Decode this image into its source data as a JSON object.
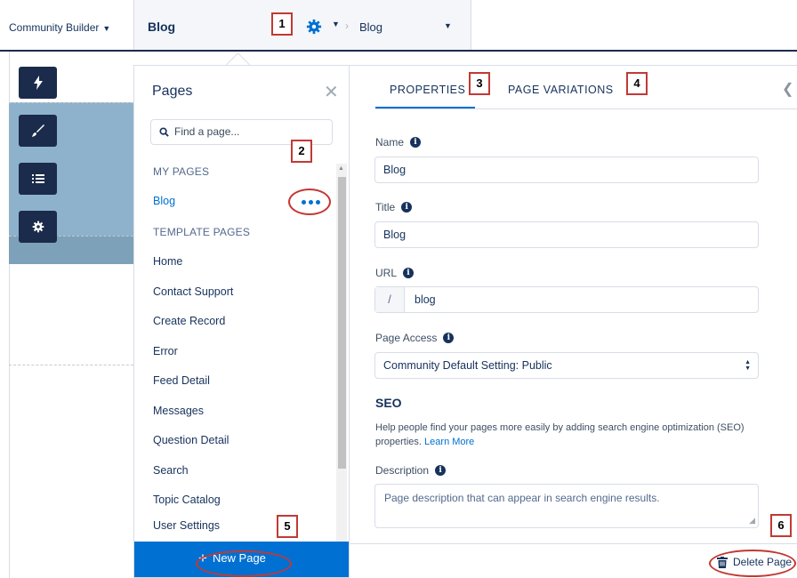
{
  "topbar": {
    "builder_label": "Community Builder",
    "current_page": "Blog",
    "page_dropdown": "Blog"
  },
  "callouts": [
    "1",
    "2",
    "3",
    "4",
    "5",
    "6"
  ],
  "pages_panel": {
    "title": "Pages",
    "search_placeholder": "Find a page...",
    "my_pages_heading": "MY PAGES",
    "my_pages": [
      "Blog"
    ],
    "template_heading": "TEMPLATE PAGES",
    "template_pages": [
      "Home",
      "Contact Support",
      "Create Record",
      "Error",
      "Feed Detail",
      "Messages",
      "Question Detail",
      "Search",
      "Topic Catalog",
      "User Settings"
    ],
    "new_page_label": "New Page"
  },
  "properties": {
    "tabs": [
      "PROPERTIES",
      "PAGE VARIATIONS"
    ],
    "name_label": "Name",
    "name_value": "Blog",
    "title_label": "Title",
    "title_value": "Blog",
    "url_label": "URL",
    "url_prefix": "/",
    "url_value": "blog",
    "access_label": "Page Access",
    "access_value": "Community Default Setting: Public",
    "seo_heading": "SEO",
    "seo_text": "Help people find your pages more easily by adding search engine optimization (SEO) properties.",
    "seo_link": "Learn More",
    "description_label": "Description",
    "description_placeholder": "Page description that can appear in search engine results.",
    "delete_label": "Delete Page"
  },
  "colors": {
    "accent": "#0070d2",
    "navy": "#1b2b4b",
    "callout": "#c23934"
  }
}
